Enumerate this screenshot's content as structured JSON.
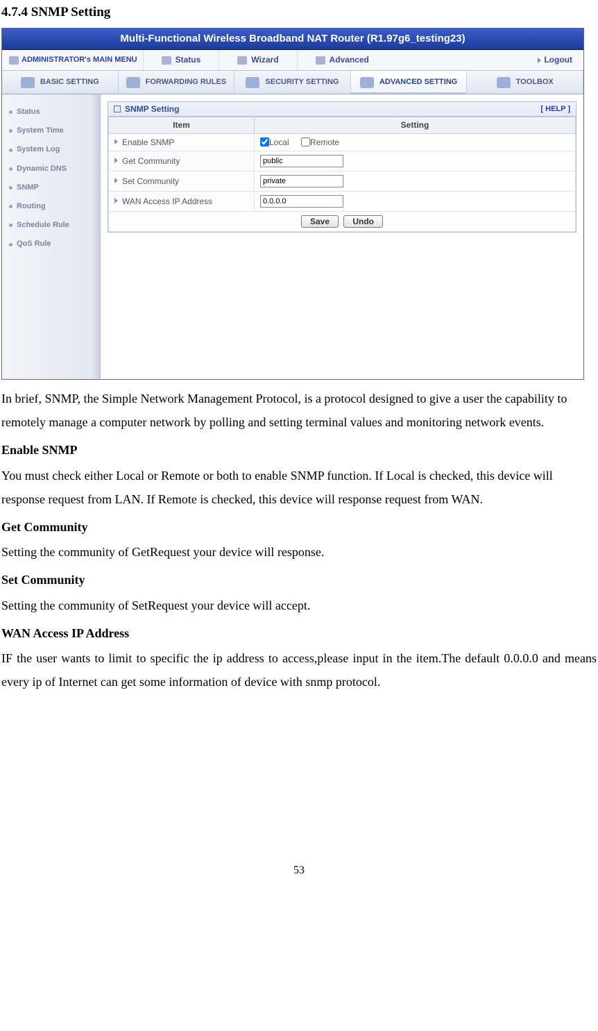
{
  "doc": {
    "heading": "4.7.4 SNMP Setting",
    "intro": "In brief, SNMP, the Simple Network Management Protocol, is a protocol designed to give a user the capability to remotely manage a computer network by polling and setting terminal values and monitoring network events.",
    "sections": {
      "enable_h": "Enable SNMP",
      "enable_p": "You must check either Local or Remote or both to enable SNMP function. If Local is checked, this device will response request from LAN. If Remote is checked, this device will response request from WAN.",
      "get_h": "Get Community",
      "get_p": "Setting the community of GetRequest your device will response.",
      "set_h": "Set Community",
      "set_p": "Setting the community of SetRequest your device will accept.",
      "wan_h": "WAN Access IP Address",
      "wan_p": "IF the user wants to limit to specific the ip address to access,please input in the item.The default 0.0.0.0 and means every ip of Internet can get some information of device with snmp protocol."
    },
    "page_num": "53"
  },
  "ui": {
    "title": "Multi-Functional Wireless Broadband NAT Router (R1.97g6_testing23)",
    "main_menu": {
      "admin": "ADMINISTRATOR's MAIN MENU",
      "items": [
        "Status",
        "Wizard",
        "Advanced"
      ],
      "logout": "Logout"
    },
    "tabs": [
      "BASIC SETTING",
      "FORWARDING RULES",
      "SECURITY SETTING",
      "ADVANCED SETTING",
      "TOOLBOX"
    ],
    "sidebar": [
      "Status",
      "System Time",
      "System Log",
      "Dynamic DNS",
      "SNMP",
      "Routing",
      "Schedule Rule",
      "QoS Rule"
    ],
    "panel": {
      "title": "SNMP Setting",
      "help": "[ HELP ]",
      "col_item": "Item",
      "col_setting": "Setting",
      "rows": {
        "enable_label": "Enable SNMP",
        "enable_local": "Local",
        "enable_remote": "Remote",
        "get_label": "Get Community",
        "get_value": "public",
        "set_label": "Set Community",
        "set_value": "private",
        "wan_label": "WAN Access IP Address",
        "wan_value": "0.0.0.0"
      },
      "buttons": {
        "save": "Save",
        "undo": "Undo"
      }
    }
  }
}
